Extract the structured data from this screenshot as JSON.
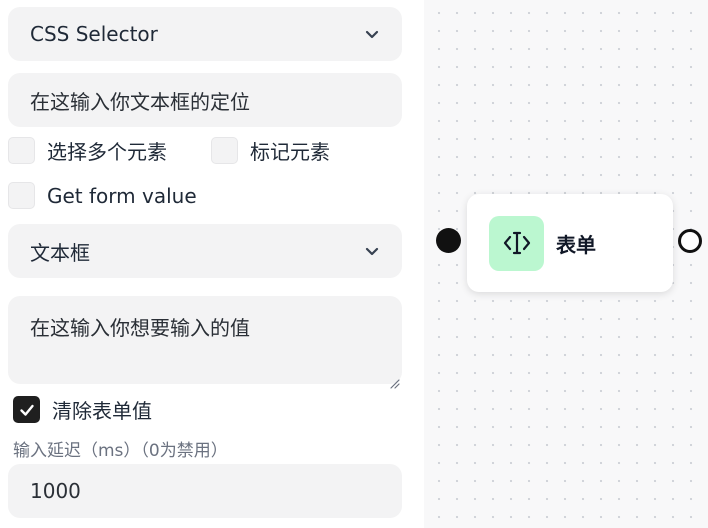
{
  "selector_type": {
    "value": "CSS Selector"
  },
  "selector_input": {
    "placeholder": "在这输入你文本框的定位"
  },
  "options": {
    "multiple_label": "选择多个元素",
    "mark_label": "标记元素",
    "get_form_value_label": "Get form value"
  },
  "form_type": {
    "value": "文本框"
  },
  "value_input": {
    "placeholder": "在这输入你想要输入的值"
  },
  "clear_form": {
    "label": "清除表单值",
    "checked": true
  },
  "delay": {
    "label": "输入延迟（ms）（0为禁用）",
    "value": "1000"
  },
  "node": {
    "title": "表单",
    "icon": "text-cursor-icon",
    "icon_bg": "#bbf7d0"
  }
}
